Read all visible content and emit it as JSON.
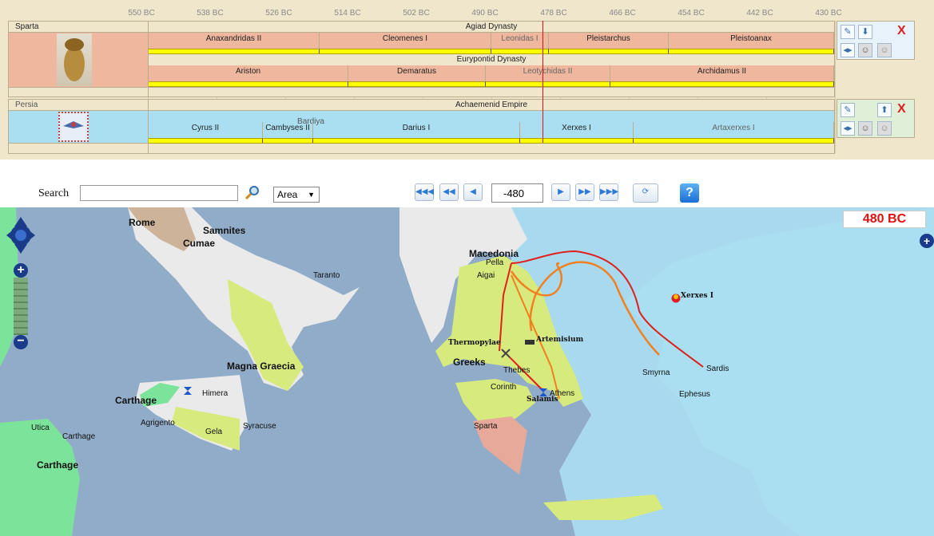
{
  "timeline": {
    "axis_years": [
      "550 BC",
      "538 BC",
      "526 BC",
      "514 BC",
      "502 BC",
      "490 BC",
      "478 BC",
      "466 BC",
      "454 BC",
      "442 BC",
      "430 BC"
    ],
    "current_marker_year": -480,
    "sparta": {
      "label": "Sparta",
      "dynasty1": "Agiad Dynasty",
      "rulers1": [
        "Anaxandridas II",
        "Cleomenes I",
        "Leonidas I",
        "Pleistarchus",
        "Pleistoanax"
      ],
      "dynasty2": "Eurypontid Dynasty",
      "rulers2": [
        "Ariston",
        "Demaratus",
        "Leotychidas II",
        "Archidamus II"
      ]
    },
    "persia": {
      "label": "Persia",
      "dynasty1": "Achaemenid Empire",
      "extra_ruler": "Bardiya",
      "rulers1": [
        "Cyrus II",
        "Cambyses II",
        "Darius I",
        "Xerxes I",
        "Artaxerxes I"
      ]
    }
  },
  "toolbar": {
    "search_label": "Search",
    "search_value": "",
    "filter_selected": "Area",
    "year_value": "-480"
  },
  "map": {
    "year_badge": "480 BC",
    "regions": [
      "Rome",
      "Samnites",
      "Cumae",
      "Magna Graecia",
      "Carthage",
      "Carthage",
      "Macedonia",
      "Greeks"
    ],
    "places": [
      "Taranto",
      "Himera",
      "Agrigento",
      "Gela",
      "Syracuse",
      "Utica",
      "Carthage",
      "Pella",
      "Aigai",
      "Thebes",
      "Corinth",
      "Athens",
      "Sparta",
      "Smyrna",
      "Sardis",
      "Ephesus"
    ],
    "battles": [
      "Thermopylae",
      "Artemisium",
      "Salamis"
    ],
    "persian_leader": "Xerxes I",
    "colors": {
      "sea": "#91acc8",
      "aegean": "#a9d9ef",
      "greeks": "#d7ea7d",
      "persia": "#a9dff0",
      "rome": "#ccb39a",
      "italy_grey": "#eaeaea",
      "carthage_green": "#7be39a",
      "sparta_pink": "#e6a99a",
      "route_red": "#e0201c",
      "route_orange": "#f08020"
    }
  }
}
